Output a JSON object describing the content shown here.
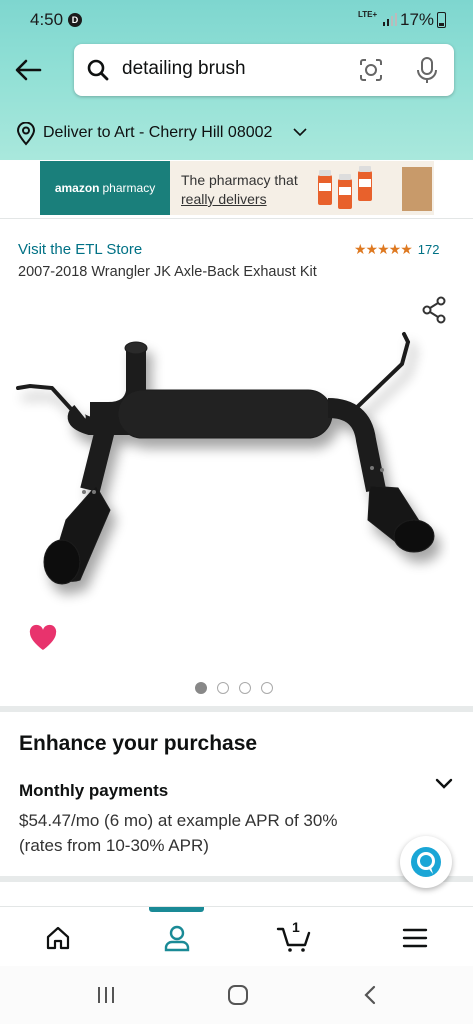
{
  "status_bar": {
    "time": "4:50",
    "notification_badge": "D",
    "network": "LTE+",
    "battery": "17%"
  },
  "search": {
    "query": "detailing brush"
  },
  "delivery": {
    "text": "Deliver to Art - Cherry Hill 08002"
  },
  "banner": {
    "brand": "amazon",
    "brand_suffix": "pharmacy",
    "line1": "The pharmacy that",
    "line2": "really delivers"
  },
  "product": {
    "store_link": "Visit the ETL Store",
    "rating_stars": "★★★★★",
    "rating_count": "172",
    "title": "2007-2018 Wrangler JK Axle-Back Exhaust Kit",
    "image_count": 4,
    "active_image": 1
  },
  "enhance": {
    "title": "Enhance your purchase",
    "monthly_label": "Monthly payments",
    "monthly_line1": "$54.47/mo (6 mo) at example APR of 30%",
    "monthly_line2": "(rates from 10-30% APR)"
  },
  "bottom_nav": {
    "cart_count": "1",
    "active_tab": "account"
  },
  "colors": {
    "header": "#8fdfd5",
    "link": "#007185",
    "star": "#de7921",
    "heart": "#e8336d",
    "accent": "#1a8a96"
  }
}
